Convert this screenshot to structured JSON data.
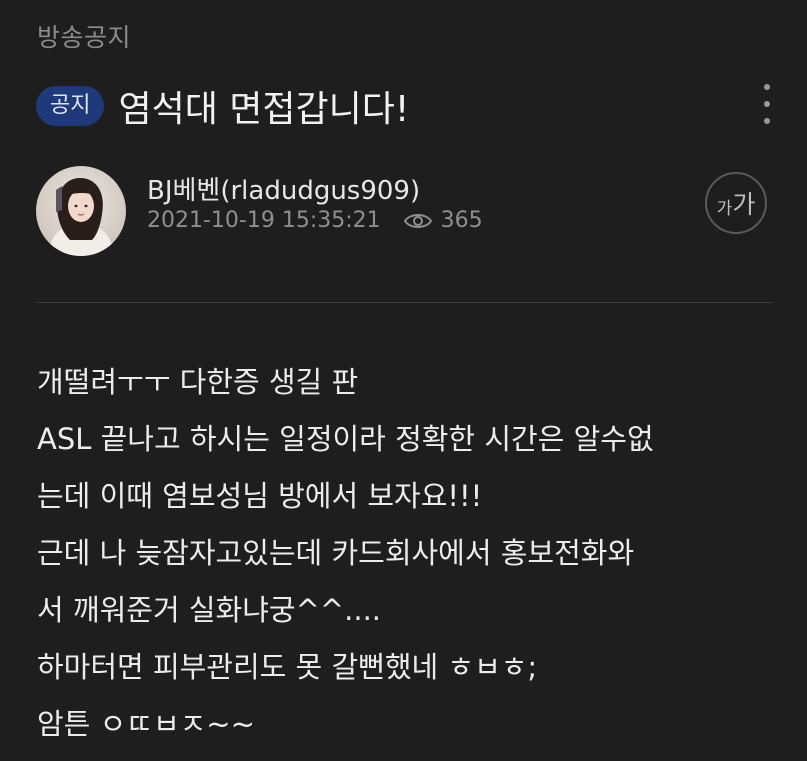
{
  "board": {
    "category": "방송공지"
  },
  "post": {
    "badge": "공지",
    "title": "염석대 면접갑니다!",
    "author": "BJ베벤(rladudgus909)",
    "datetime": "2021-10-19 15:35:21",
    "views": "365",
    "body_lines": [
      "개떨려ㅜㅜ 다한증 생길 판",
      "ASL 끝나고 하시는 일정이라 정확한 시간은 알수없",
      "는데 이때 염보성님 방에서 보자요!!!",
      "근데 나 늦잠자고있는데 카드회사에서 홍보전화와",
      "서 깨워준거 실화냐궁^^....",
      "하마터면 피부관리도 못 갈뻔했네 ㅎㅂㅎ;",
      "암튼 ㅇㄸㅂㅈ~~"
    ]
  },
  "controls": {
    "font_size_small": "가",
    "font_size_big": "가"
  },
  "icons": {
    "more": "more-vertical-icon",
    "views": "eye-icon",
    "font_size": "font-size-icon"
  },
  "colors": {
    "background": "#1e1e1e",
    "badge_background": "#1f3a7a",
    "muted_text": "#8c8c8c"
  }
}
